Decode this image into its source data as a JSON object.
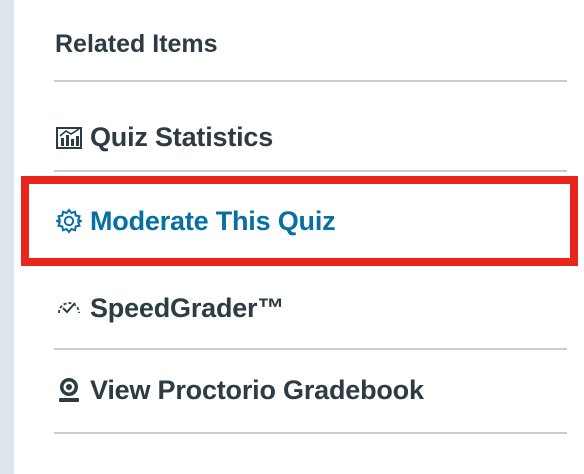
{
  "related": {
    "heading": "Related Items",
    "items": [
      {
        "label": "Quiz Statistics",
        "icon": "chart-icon"
      },
      {
        "label": "Moderate This Quiz",
        "icon": "gear-icon"
      },
      {
        "label": "SpeedGrader™",
        "icon": "speedgrader-icon"
      },
      {
        "label": "View Proctorio Gradebook",
        "icon": "proctorio-icon"
      }
    ]
  },
  "colors": {
    "text": "#2d3b45",
    "link": "#0770a3",
    "highlight": "#e8261d",
    "divider": "#c7cdd1",
    "background": "#dde6ea"
  }
}
